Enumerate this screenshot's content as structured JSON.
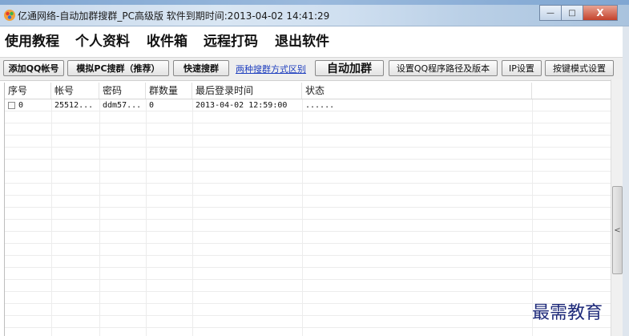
{
  "window": {
    "title": "亿通网络-自动加群搜群_PC高级版 软件到期时间:2013-04-02 14:41:29",
    "controls": {
      "minimize": "—",
      "maximize": "□",
      "close": "X"
    }
  },
  "menu": [
    {
      "label": "使用教程"
    },
    {
      "label": "个人资料"
    },
    {
      "label": "收件箱"
    },
    {
      "label": "远程打码"
    },
    {
      "label": "退出软件"
    }
  ],
  "toolbar": {
    "add_qq": "添加QQ帐号",
    "simulate_pc": "模拟PC搜群（推荐）",
    "quick_search": "快速搜群",
    "compare_link": "两种搜群方式区别",
    "auto_join": "自动加群",
    "set_qq_path": "设置QQ程序路径及版本",
    "ip_settings": "IP设置",
    "hotkey_settings": "按键模式设置"
  },
  "table": {
    "columns": [
      "序号",
      "帐号",
      "密码",
      "群数量",
      "最后登录时间",
      "状态"
    ],
    "rows": [
      {
        "index": "0",
        "account": "25512...",
        "password": "ddm57...",
        "groups": "0",
        "last_login": "2013-04-02 12:59:00",
        "status": "......"
      }
    ]
  },
  "scrollbar": {
    "arrow": "<"
  },
  "watermark": "最需教育",
  "icons": {
    "app": "app-icon"
  }
}
